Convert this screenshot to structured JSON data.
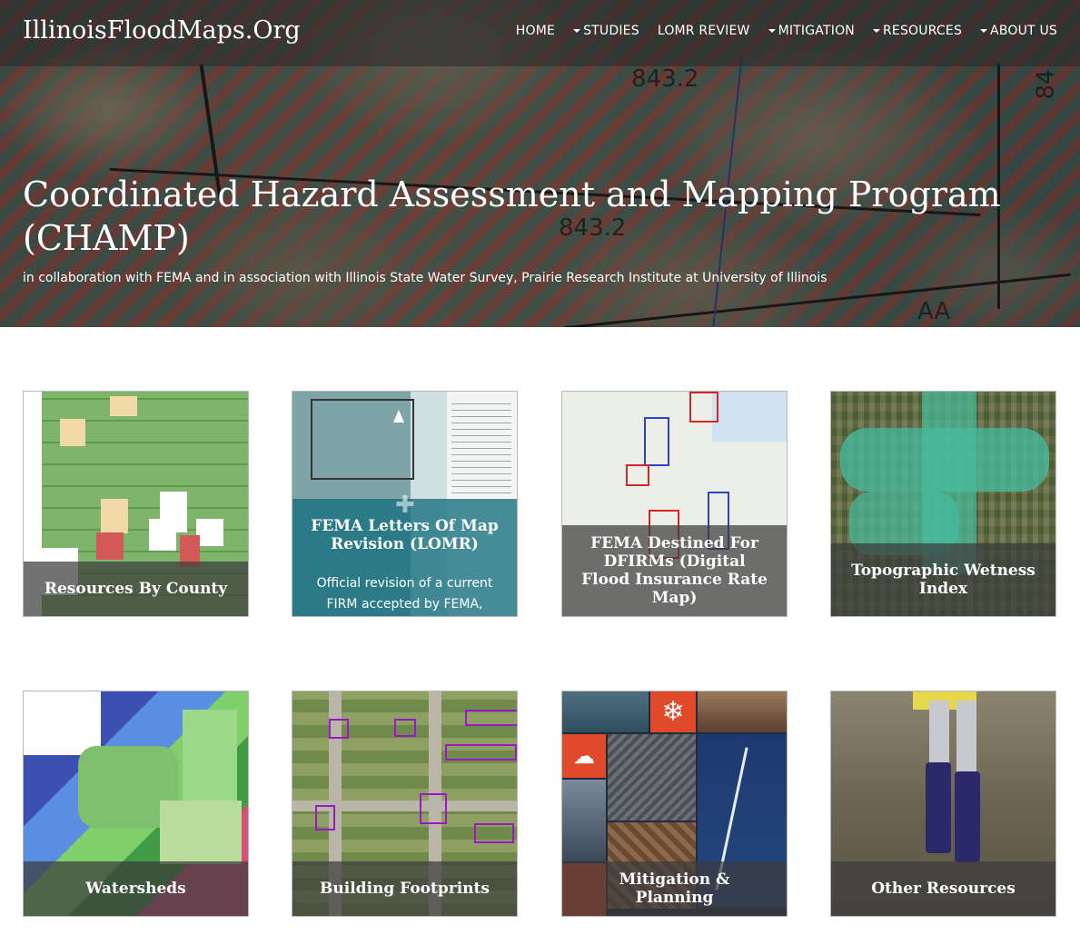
{
  "header": {
    "brand": "IllinoisFloodMaps.Org",
    "nav": [
      {
        "label": "HOME",
        "dropdown": false
      },
      {
        "label": "STUDIES",
        "dropdown": true
      },
      {
        "label": "LOMR REVIEW",
        "dropdown": false
      },
      {
        "label": "MITIGATION",
        "dropdown": true
      },
      {
        "label": "RESOURCES",
        "dropdown": true
      },
      {
        "label": "ABOUT US",
        "dropdown": true
      }
    ]
  },
  "hero": {
    "title": "Coordinated Hazard Assessment and Mapping Program (CHAMP)",
    "subtitle": "in collaboration with FEMA and in association with Illinois State Water Survey, Prairie Research Institute at University of Illinois",
    "map_labels": [
      "843.2",
      "843.2",
      "84",
      "AA"
    ]
  },
  "tiles": [
    {
      "title": "Resources By County"
    },
    {
      "title": "FEMA Letters Of Map Revision (LOMR)",
      "description": "Official revision of a current FIRM accepted by FEMA,"
    },
    {
      "title": "FEMA Destined For DFIRMs (Digital Flood Insurance Rate Map)"
    },
    {
      "title": "Topographic Wetness Index"
    },
    {
      "title": "Watersheds"
    },
    {
      "title": "Building Footprints"
    },
    {
      "title": "Mitigation & Planning"
    },
    {
      "title": "Other Resources"
    }
  ],
  "colors": {
    "navbar_bg": "#282828",
    "lomr_overlay": "#146e7d",
    "caption_bg": "#3c3c3c"
  }
}
